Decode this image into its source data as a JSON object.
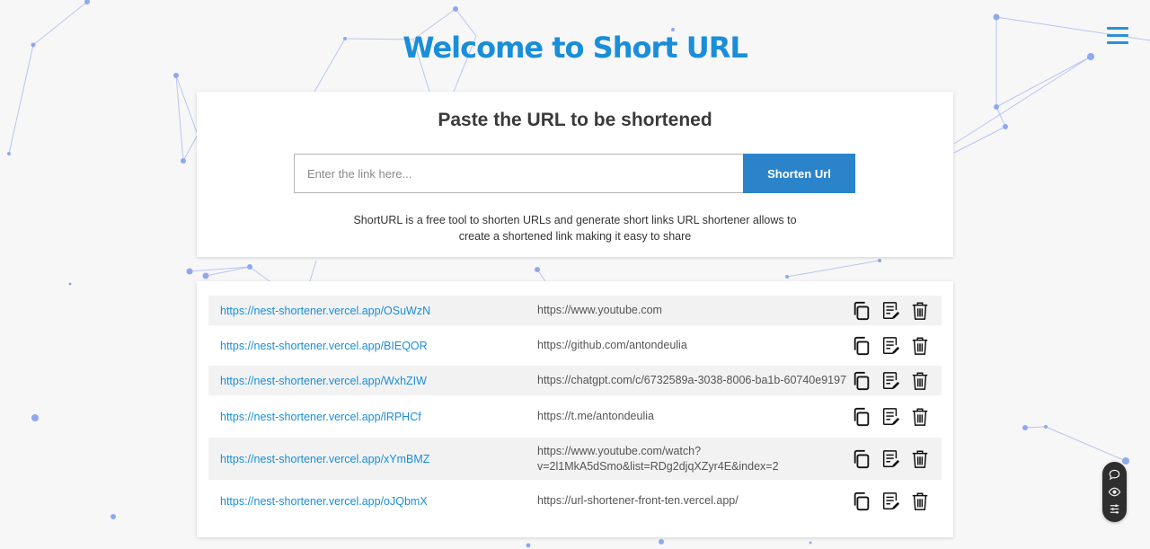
{
  "header": {
    "title": "Welcome to Short URL",
    "menu_icon": "hamburger-menu-icon"
  },
  "shortener": {
    "heading": "Paste the URL to be shortened",
    "input_value": "",
    "input_placeholder": "Enter the link here...",
    "button_label": "Shorten Url",
    "description_line1": "ShortURL is a free tool to shorten URLs and generate short links URL shortener allows to",
    "description_line2": "create a shortened link making it easy to share"
  },
  "links": [
    {
      "short": "https://nest-shortener.vercel.app/OSuWzN",
      "original": "https://www.youtube.com"
    },
    {
      "short": "https://nest-shortener.vercel.app/BIEQOR",
      "original": "https://github.com/antondeulia"
    },
    {
      "short": "https://nest-shortener.vercel.app/WxhZIW",
      "original": "https://chatgpt.com/c/6732589a-3038-8006-ba1b-60740e91977c"
    },
    {
      "short": "https://nest-shortener.vercel.app/lRPHCf",
      "original": "https://t.me/antondeulia"
    },
    {
      "short": "https://nest-shortener.vercel.app/xYmBMZ",
      "original_line1": "https://www.youtube.com/watch?",
      "original_line2": "v=2l1MkA5dSmo&list=RDg2djqXZyr4E&index=2"
    },
    {
      "short": "https://nest-shortener.vercel.app/oJQbmX",
      "original": "https://url-shortener-front-ten.vercel.app/"
    }
  ],
  "row_icons": {
    "copy": "copy-icon",
    "edit": "edit-icon",
    "delete": "trash-icon"
  },
  "widget_icons": [
    "chat-icon",
    "eye-icon",
    "settings-icon"
  ],
  "colors": {
    "accent": "#1a8ed8",
    "button": "#2b84c9",
    "network": "#8fa8f0"
  }
}
